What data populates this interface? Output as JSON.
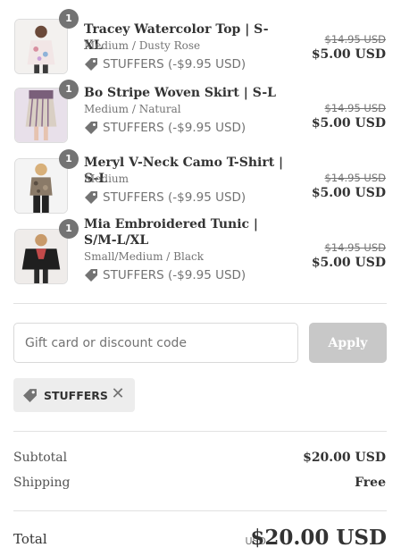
{
  "items": [
    {
      "title": "Tracey Watercolor Top | S-XL",
      "variant": "Medium / Dusty Rose",
      "qty": "1",
      "discount": "STUFFERS (-$9.95 USD)",
      "old_price": "$14.95 USD",
      "new_price": "$5.00 USD"
    },
    {
      "title": "Bo Stripe Woven Skirt | S-L",
      "variant": "Medium / Natural",
      "qty": "1",
      "discount": "STUFFERS (-$9.95 USD)",
      "old_price": "$14.95 USD",
      "new_price": "$5.00 USD"
    },
    {
      "title": "Meryl V-Neck Camo T-Shirt | S-L",
      "variant": "Medium",
      "qty": "1",
      "discount": "STUFFERS (-$9.95 USD)",
      "old_price": "$14.95 USD",
      "new_price": "$5.00 USD"
    },
    {
      "title": "Mia Embroidered Tunic | S/M-L/XL",
      "variant": "Small/Medium / Black",
      "qty": "1",
      "discount": "STUFFERS (-$9.95 USD)",
      "old_price": "$14.95 USD",
      "new_price": "$5.00 USD"
    }
  ],
  "discount_form": {
    "placeholder": "Gift card or discount code",
    "apply_label": "Apply"
  },
  "applied_code": {
    "label": "STUFFERS",
    "remove_glyph": "✕"
  },
  "totals": {
    "subtotal_label": "Subtotal",
    "subtotal_value": "$20.00 USD",
    "shipping_label": "Shipping",
    "shipping_value": "Free",
    "total_label": "Total",
    "total_currency": "USD",
    "total_value": "$20.00 USD"
  }
}
